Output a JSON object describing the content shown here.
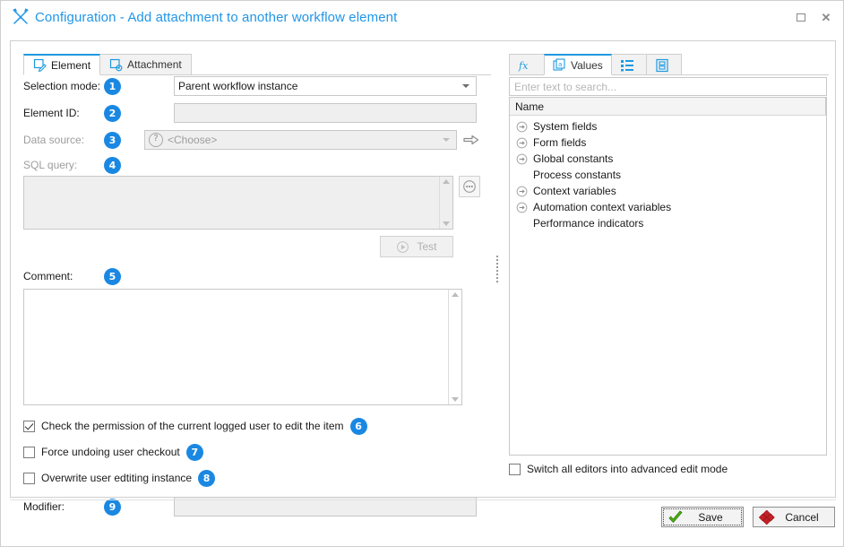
{
  "window": {
    "title": "Configuration - Add attachment to another workflow element",
    "title_icon": "tools-icon",
    "maximize_label": "Maximize",
    "close_label": "Close"
  },
  "left": {
    "tabs": [
      {
        "label": "Element",
        "icon": "document-pencil-icon",
        "active": true
      },
      {
        "label": "Attachment",
        "icon": "document-gear-icon",
        "active": false
      }
    ],
    "fields": {
      "selection_mode": {
        "label": "Selection mode:",
        "badge": "1",
        "value": "Parent workflow instance",
        "disabled": false
      },
      "element_id": {
        "label": "Element ID:",
        "badge": "2",
        "value": "",
        "disabled": true
      },
      "data_source": {
        "label": "Data source:",
        "badge": "3",
        "value": "<Choose>",
        "disabled": true,
        "help_icon": "question-icon",
        "go_icon": "arrow-right-icon"
      },
      "sql_query": {
        "label": "SQL query:",
        "badge": "4",
        "value": "",
        "disabled": true,
        "ellipsis_label": "...",
        "ellipsis_icon": "ellipsis-icon"
      },
      "comment": {
        "label": "Comment:",
        "badge": "5",
        "value": "",
        "disabled": false
      },
      "modifier": {
        "label": "Modifier:",
        "badge": "9",
        "value": "",
        "disabled": true
      }
    },
    "test_button": {
      "label": "Test",
      "icon": "play-icon",
      "disabled": true
    },
    "checkboxes": [
      {
        "label": "Check the permission of the current logged user to edit the item",
        "badge": "6",
        "checked": true
      },
      {
        "label": "Force undoing user checkout",
        "badge": "7",
        "checked": false
      },
      {
        "label": "Overwrite user edtiting instance",
        "badge": "8",
        "checked": false
      }
    ]
  },
  "right": {
    "tabs": [
      {
        "label": "",
        "icon": "fx-icon",
        "active": false
      },
      {
        "label": "Values",
        "icon": "values-icon",
        "active": true
      },
      {
        "label": "",
        "icon": "list-icon",
        "active": false
      },
      {
        "label": "",
        "icon": "document-icon",
        "active": false
      }
    ],
    "search": {
      "placeholder": "Enter text to search...",
      "value": ""
    },
    "tree_header": "Name",
    "tree_items": [
      {
        "label": "System fields",
        "expandable": true
      },
      {
        "label": "Form fields",
        "expandable": true
      },
      {
        "label": "Global constants",
        "expandable": true
      },
      {
        "label": "Process constants",
        "expandable": false
      },
      {
        "label": "Context variables",
        "expandable": true
      },
      {
        "label": "Automation context variables",
        "expandable": true
      },
      {
        "label": "Performance indicators",
        "expandable": false
      }
    ],
    "advanced_mode": {
      "label": "Switch all editors into advanced edit mode",
      "checked": false
    }
  },
  "footer": {
    "save": {
      "label": "Save",
      "icon": "green-check-icon",
      "focused": true
    },
    "cancel": {
      "label": "Cancel",
      "icon": "red-x-icon",
      "focused": false
    }
  },
  "colors": {
    "accent": "#1e9ae0",
    "title_text": "#2196e8",
    "badge": "#1a88e2",
    "save_icon": "#3fa513",
    "cancel_icon": "#c42126"
  }
}
